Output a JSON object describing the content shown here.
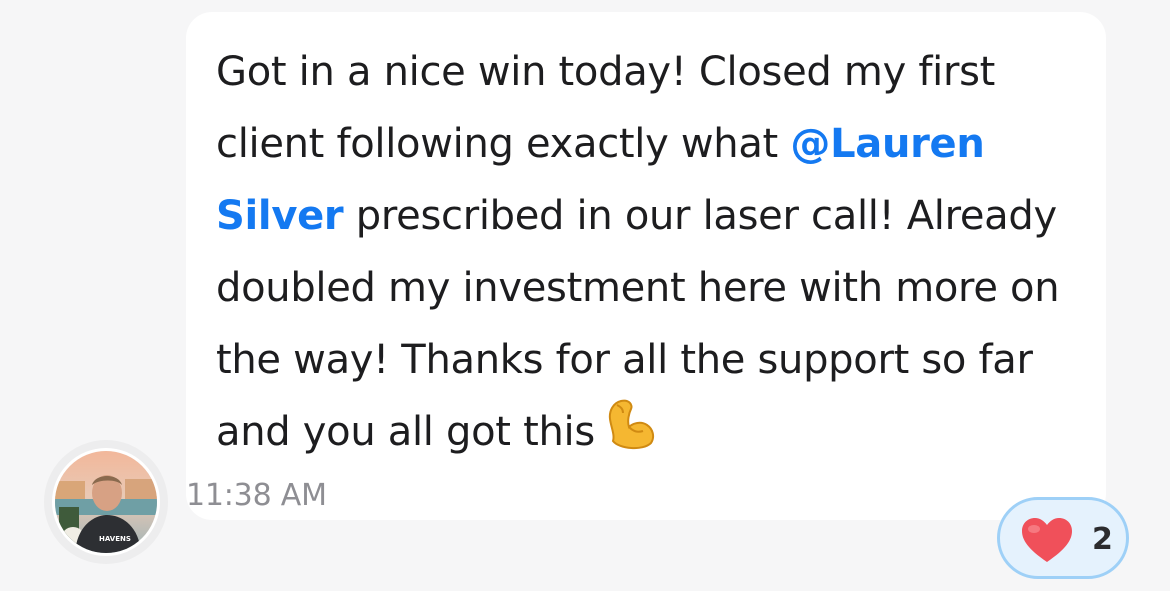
{
  "message": {
    "text_before_mention": "Got in a nice win today! Closed my first client following exactly what ",
    "mention": "@Lauren Silver",
    "text_after_mention": " prescribed in our laser call! Already doubled my investment here with more on the way! Thanks for all the support so far and you all got this",
    "emoji": "flexed-biceps-icon",
    "timestamp": "11:38 AM"
  },
  "author": {
    "avatar": "user-avatar-photo"
  },
  "reaction": {
    "icon": "heart-icon",
    "count": "2"
  },
  "colors": {
    "mention": "#1479f1",
    "reaction_border": "#9ed0f7",
    "reaction_background": "#e5f2fd",
    "heart": "#f0505a",
    "bubble": "#ffffff",
    "page_background": "#f6f6f7"
  }
}
